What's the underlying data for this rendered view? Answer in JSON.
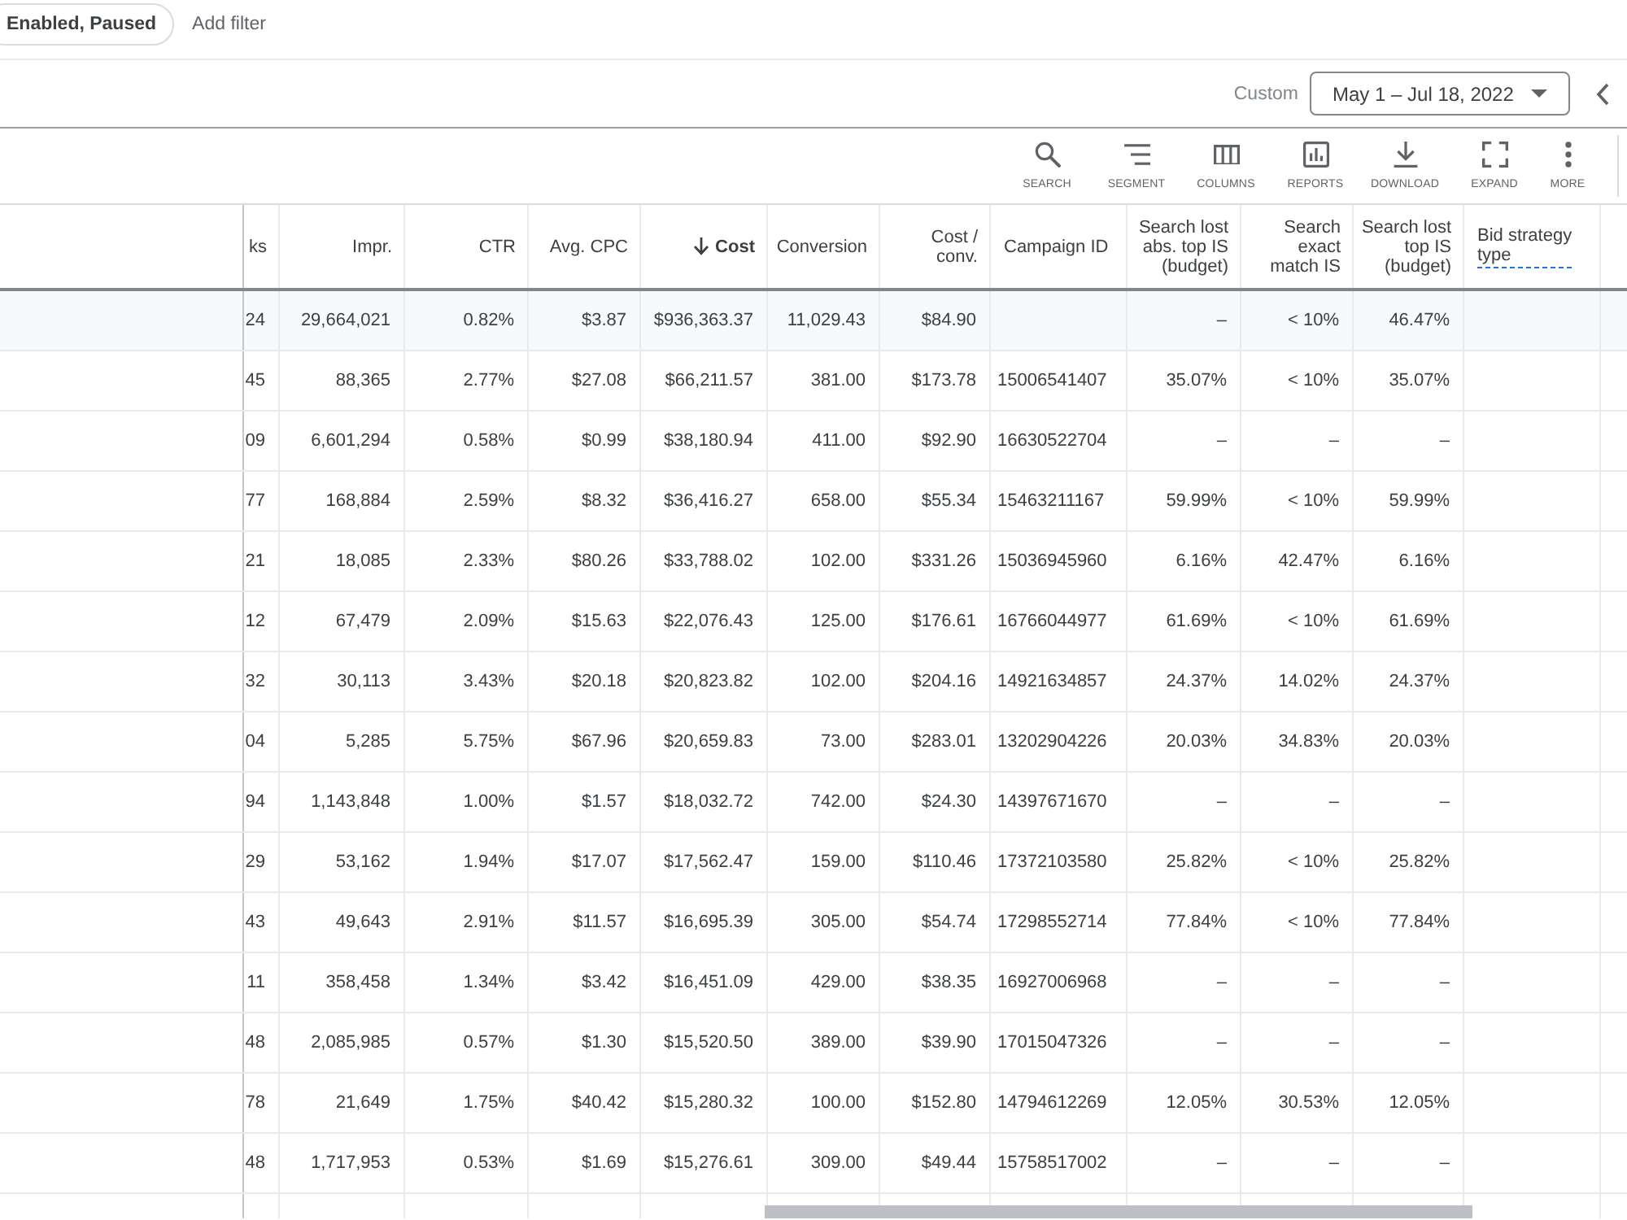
{
  "filter_bar": {
    "chip": "Enabled, Paused",
    "add_filter": "Add filter"
  },
  "date_range": {
    "label": "Custom",
    "value": "May 1 – Jul 18, 2022"
  },
  "toolbar": [
    {
      "kind": "search",
      "label": "SEARCH"
    },
    {
      "kind": "segment",
      "label": "SEGMENT"
    },
    {
      "kind": "columns",
      "label": "COLUMNS"
    },
    {
      "kind": "reports",
      "label": "REPORTS"
    },
    {
      "kind": "download",
      "label": "DOWNLOAD"
    },
    {
      "kind": "expand",
      "label": "EXPAND"
    },
    {
      "kind": "more",
      "label": "MORE"
    }
  ],
  "table": {
    "columns": [
      {
        "label": "ks",
        "kind": "number",
        "sorted": false,
        "has_help": false
      },
      {
        "label": "Impr.",
        "kind": "number",
        "sorted": false,
        "has_help": false
      },
      {
        "label": "CTR",
        "kind": "number",
        "sorted": false,
        "has_help": false
      },
      {
        "label": "Avg. CPC",
        "kind": "number",
        "sorted": false,
        "has_help": false
      },
      {
        "label": "Cost",
        "kind": "number",
        "sorted": true,
        "has_help": false
      },
      {
        "label": "Conversion",
        "kind": "number",
        "sorted": false,
        "has_help": false
      },
      {
        "label": "Cost /\nconv.",
        "kind": "number",
        "sorted": false,
        "has_help": false
      },
      {
        "label": "Campaign ID",
        "kind": "text",
        "sorted": false,
        "has_help": false
      },
      {
        "label": "Search lost\nabs. top IS\n(budget)",
        "kind": "number",
        "sorted": false,
        "has_help": false
      },
      {
        "label": "Search\nexact\nmatch IS",
        "kind": "number",
        "sorted": false,
        "has_help": false
      },
      {
        "label": "Search lost\ntop IS\n(budget)",
        "kind": "number",
        "sorted": false,
        "has_help": false
      },
      {
        "label": "Bid strategy\ntype",
        "kind": "text",
        "sorted": false,
        "has_help": true
      }
    ],
    "rows": [
      {
        "kind": "total",
        "cells": [
          "24",
          "29,664,021",
          "0.82%",
          "$3.87",
          "$936,363.37",
          "11,029.43",
          "$84.90",
          null,
          "–",
          "< 10%",
          "46.47%"
        ]
      },
      {
        "kind": "campaign",
        "cells": [
          "45",
          "88,365",
          "2.77%",
          "$27.08",
          "$66,211.57",
          "381.00",
          "$173.78",
          "15006541407",
          "35.07%",
          "< 10%",
          "35.07%"
        ]
      },
      {
        "kind": "campaign",
        "cells": [
          "09",
          "6,601,294",
          "0.58%",
          "$0.99",
          "$38,180.94",
          "411.00",
          "$92.90",
          "16630522704",
          "–",
          "–",
          "–"
        ]
      },
      {
        "kind": "campaign",
        "cells": [
          "77",
          "168,884",
          "2.59%",
          "$8.32",
          "$36,416.27",
          "658.00",
          "$55.34",
          "15463211167",
          "59.99%",
          "< 10%",
          "59.99%"
        ]
      },
      {
        "kind": "campaign",
        "cells": [
          "21",
          "18,085",
          "2.33%",
          "$80.26",
          "$33,788.02",
          "102.00",
          "$331.26",
          "15036945960",
          "6.16%",
          "42.47%",
          "6.16%"
        ]
      },
      {
        "kind": "campaign",
        "cells": [
          "12",
          "67,479",
          "2.09%",
          "$15.63",
          "$22,076.43",
          "125.00",
          "$176.61",
          "16766044977",
          "61.69%",
          "< 10%",
          "61.69%"
        ]
      },
      {
        "kind": "campaign",
        "cells": [
          "32",
          "30,113",
          "3.43%",
          "$20.18",
          "$20,823.82",
          "102.00",
          "$204.16",
          "14921634857",
          "24.37%",
          "14.02%",
          "24.37%"
        ]
      },
      {
        "kind": "campaign",
        "cells": [
          "04",
          "5,285",
          "5.75%",
          "$67.96",
          "$20,659.83",
          "73.00",
          "$283.01",
          "13202904226",
          "20.03%",
          "34.83%",
          "20.03%"
        ]
      },
      {
        "kind": "campaign",
        "cells": [
          "94",
          "1,143,848",
          "1.00%",
          "$1.57",
          "$18,032.72",
          "742.00",
          "$24.30",
          "14397671670",
          "–",
          "–",
          "–"
        ]
      },
      {
        "kind": "campaign",
        "cells": [
          "29",
          "53,162",
          "1.94%",
          "$17.07",
          "$17,562.47",
          "159.00",
          "$110.46",
          "17372103580",
          "25.82%",
          "< 10%",
          "25.82%"
        ]
      },
      {
        "kind": "campaign",
        "cells": [
          "43",
          "49,643",
          "2.91%",
          "$11.57",
          "$16,695.39",
          "305.00",
          "$54.74",
          "17298552714",
          "77.84%",
          "< 10%",
          "77.84%"
        ]
      },
      {
        "kind": "campaign",
        "cells": [
          "11",
          "358,458",
          "1.34%",
          "$3.42",
          "$16,451.09",
          "429.00",
          "$38.35",
          "16927006968",
          "–",
          "–",
          "–"
        ]
      },
      {
        "kind": "campaign",
        "cells": [
          "48",
          "2,085,985",
          "0.57%",
          "$1.30",
          "$15,520.50",
          "389.00",
          "$39.90",
          "17015047326",
          "–",
          "–",
          "–"
        ]
      },
      {
        "kind": "campaign",
        "cells": [
          "78",
          "21,649",
          "1.75%",
          "$40.42",
          "$15,280.32",
          "100.00",
          "$152.80",
          "14794612269",
          "12.05%",
          "30.53%",
          "12.05%"
        ]
      },
      {
        "kind": "campaign",
        "cells": [
          "48",
          "1,717,953",
          "0.53%",
          "$1.69",
          "$15,276.61",
          "309.00",
          "$49.44",
          "15758517002",
          "–",
          "–",
          "–"
        ]
      }
    ]
  }
}
